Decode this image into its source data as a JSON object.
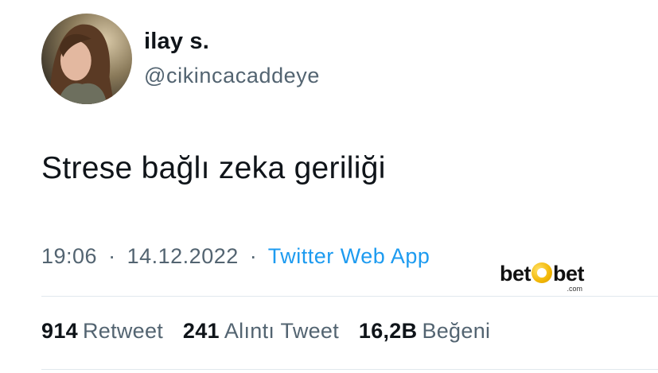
{
  "author": {
    "display_name": "ilay s.",
    "handle": "@cikincacaddeye"
  },
  "tweet": {
    "text": "Strese bağlı zeka geriliği",
    "time": "19:06",
    "separator": "·",
    "date": "14.12.2022",
    "source": "Twitter Web App"
  },
  "watermark": {
    "left": "bet",
    "right": "bet",
    "sub": ".com"
  },
  "stats": {
    "retweets": {
      "count": "914",
      "label": "Retweet"
    },
    "quotes": {
      "count": "241",
      "label": "Alıntı Tweet"
    },
    "likes": {
      "count": "16,2B",
      "label": "Beğeni"
    }
  },
  "colors": {
    "text": "#0f1419",
    "secondary": "#536471",
    "link": "#1d9bf0",
    "divider": "#e1e8ed",
    "brand_accent": "#f2b705"
  }
}
